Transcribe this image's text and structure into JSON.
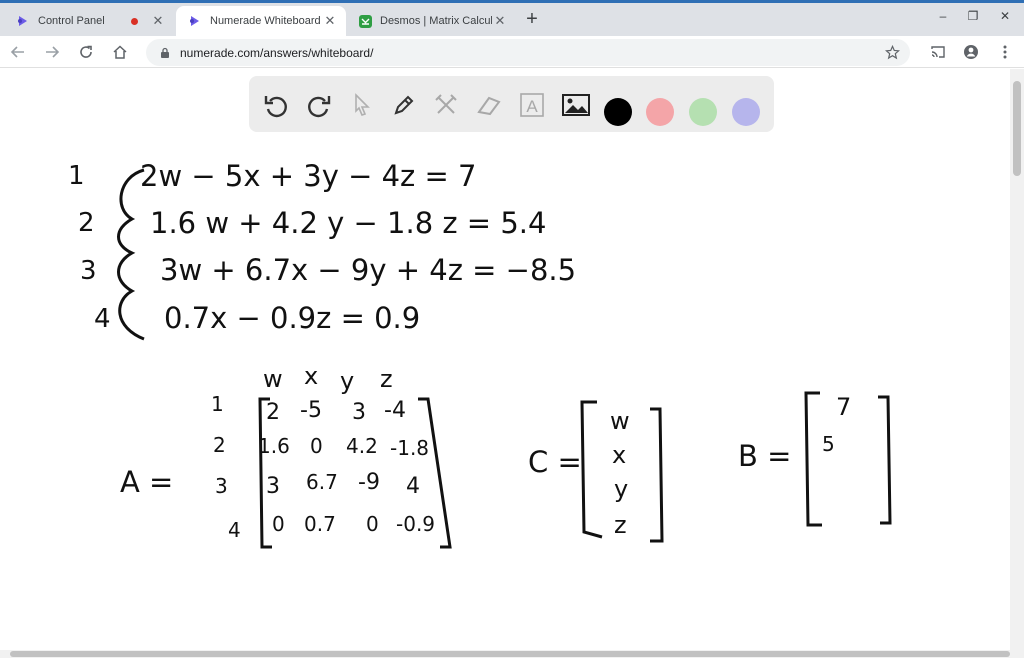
{
  "browser": {
    "tabs": [
      {
        "title": "Control Panel",
        "close": "✕"
      },
      {
        "title": "Numerade Whiteboard",
        "close": "✕"
      },
      {
        "title": "Desmos | Matrix Calculator",
        "close": "✕"
      }
    ],
    "new_tab": "+",
    "url": "numerade.com/answers/whiteboard/",
    "window_controls": {
      "minimize": "–",
      "restore": "❐",
      "close": "✕"
    },
    "accent_color": "#2f6fb5"
  },
  "whiteboard": {
    "tools": [
      "undo-icon",
      "redo-icon",
      "pointer-icon",
      "pen-icon",
      "tools-icon",
      "eraser-icon",
      "text-icon",
      "image-icon"
    ],
    "text_tool_label": "A",
    "colors": [
      "#000000",
      "#f4a5a8",
      "#b5e0b1",
      "#b6b5ec"
    ],
    "equations": [
      {
        "row": "1",
        "text": "2w  −  5x  +  3y  − 4z  =  7"
      },
      {
        "row": "2",
        "text": "1.6 w  + 4.2 y  − 1.8 z  =  5.4"
      },
      {
        "row": "3",
        "text": "3w  +  6.7x  − 9y  + 4z  =  −8.5"
      },
      {
        "row": "4",
        "text": "0.7x  −  0.9z  =  0.9"
      }
    ],
    "matrix_A": {
      "label": "A =",
      "col_headers": [
        "w",
        "x",
        "y",
        "z"
      ],
      "row_labels": [
        "1",
        "2",
        "3",
        "4"
      ],
      "rows": [
        [
          "2",
          "-5",
          "3",
          "-4"
        ],
        [
          "1.6",
          "0",
          "4.2",
          "-1.8"
        ],
        [
          "3",
          "6.7",
          "-9",
          "4"
        ],
        [
          "0",
          "0.7",
          "0",
          "-0.9"
        ]
      ]
    },
    "matrix_C": {
      "label": "C =",
      "entries": [
        "w",
        "x",
        "y",
        "z"
      ]
    },
    "matrix_B": {
      "label": "B =",
      "entries": [
        "7",
        "5"
      ]
    }
  }
}
